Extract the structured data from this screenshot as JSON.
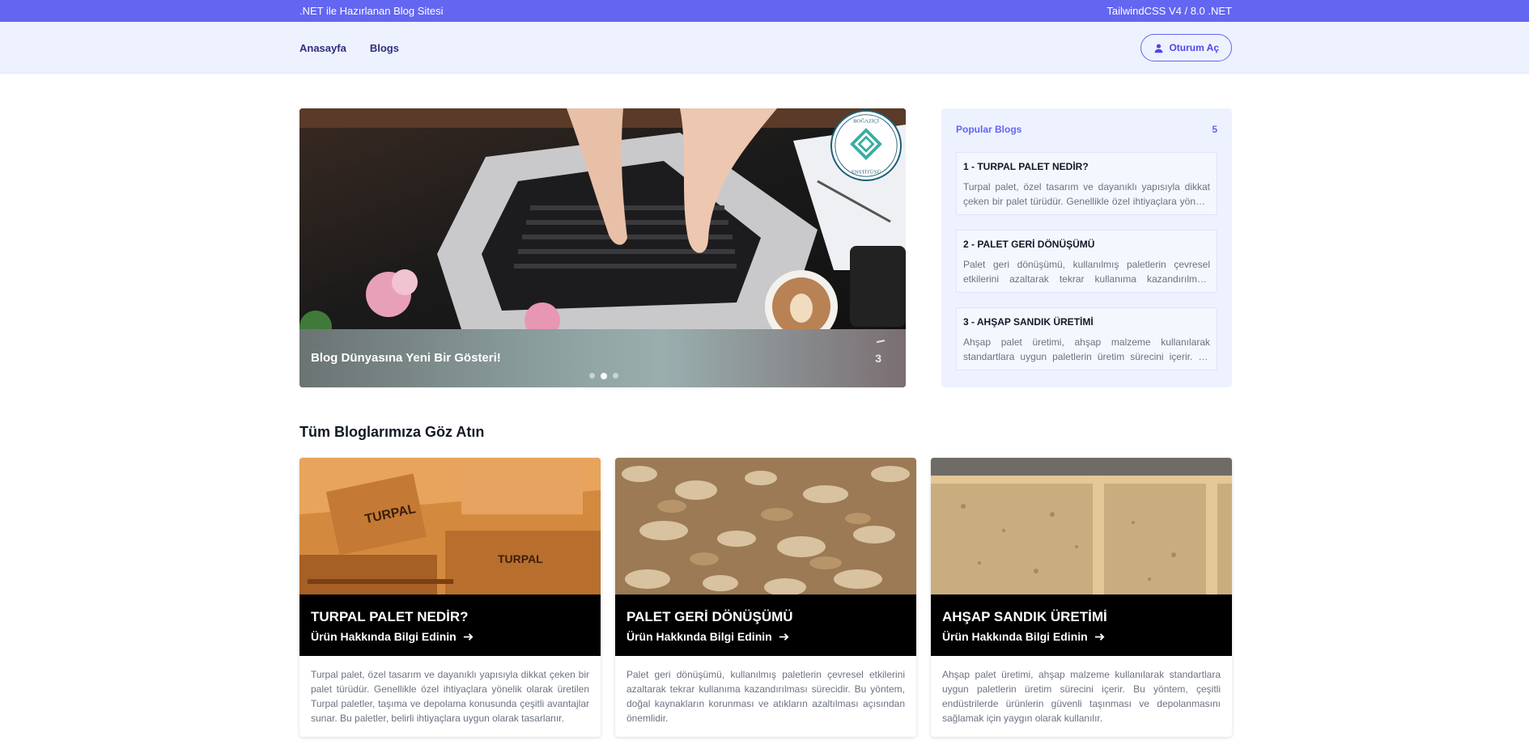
{
  "topbar": {
    "left_text": ".NET ile Hazırlanan Blog Sitesi",
    "right_text": "TailwindCSS V4 / 8.0 .NET"
  },
  "nav": {
    "links": [
      {
        "label": "Anasayfa"
      },
      {
        "label": "Blogs"
      }
    ],
    "login_label": "Oturum Aç",
    "login_icon": "user-icon"
  },
  "slider": {
    "caption": "Blog Dünyasına Yeni Bir Gösteri!",
    "counter": "3",
    "active_slide": 2,
    "slide_count": 3,
    "logo_text": "BOĞAZİÇİ ENSTİTÜSÜ"
  },
  "popular": {
    "title": "Popular Blogs",
    "count": "5",
    "items": [
      {
        "title": "1 - TURPAL PALET NEDİR?",
        "desc": "Turpal palet, özel tasarım ve dayanıklı yapısıyla dikkat çeken bir palet türüdür. Genellikle özel ihtiyaçlara yönelik olarak üretilen Turpal paletler..."
      },
      {
        "title": "2 - PALET GERİ DÖNÜŞÜMÜ",
        "desc": "Palet geri dönüşümü, kullanılmış paletlerin çevresel etkilerini azaltarak tekrar kullanıma kazandırılması sürecidir..."
      },
      {
        "title": "3 - AHŞAP SANDIK ÜRETİMİ",
        "desc": "Ahşap palet üretimi, ahşap malzeme kullanılarak standartlara uygun paletlerin üretim sürecini içerir. Bu yöntem..."
      }
    ]
  },
  "section_title": "Tüm Bloglarımıza Göz Atın",
  "cards": [
    {
      "title": "TURPAL PALET NEDİR?",
      "link": "Ürün Hakkında Bilgi Edinin",
      "desc": "Turpal palet, özel tasarım ve dayanıklı yapısıyla dikkat çeken bir palet türüdür. Genellikle özel ihtiyaçlara yönelik olarak üretilen Turpal paletler, taşıma ve depolama konusunda çeşitli avantajlar sunar. Bu paletler, belirli ihtiyaçlara uygun olarak tasarlanır."
    },
    {
      "title": "PALET GERİ DÖNÜŞÜMÜ",
      "link": "Ürün Hakkında Bilgi Edinin",
      "desc": "Palet geri dönüşümü, kullanılmış paletlerin çevresel etkilerini azaltarak tekrar kullanıma kazandırılması sürecidir. Bu yöntem, doğal kaynakların korunması ve atıkların azaltılması açısından önemlidir."
    },
    {
      "title": "AHŞAP SANDIK ÜRETİMİ",
      "link": "Ürün Hakkında Bilgi Edinin",
      "desc": "Ahşap palet üretimi, ahşap malzeme kullanılarak standartlara uygun paletlerin üretim sürecini içerir. Bu yöntem, çeşitli endüstrilerde ürünlerin güvenli taşınması ve depolanmasını sağlamak için yaygın olarak kullanılır."
    }
  ],
  "colors": {
    "accent": "#6366f1",
    "nav_bg": "#eef2ff",
    "card_band": "#000000"
  }
}
